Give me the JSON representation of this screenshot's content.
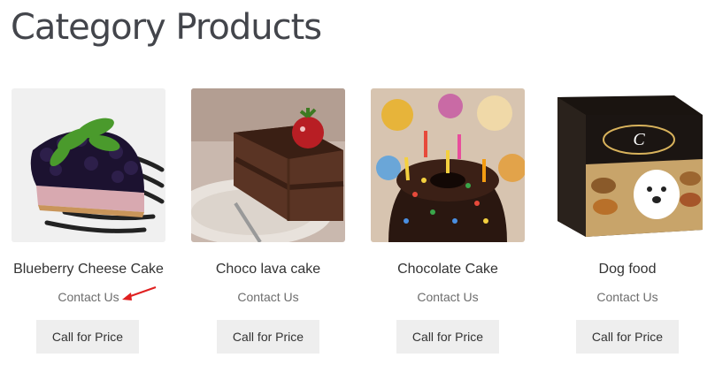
{
  "page_title": "Category Products",
  "products": [
    {
      "name": "Blueberry Cheese Cake",
      "contact_label": "Contact Us",
      "button_label": "Call for Price",
      "image": "blueberry-cheesecake-image"
    },
    {
      "name": "Choco lava cake",
      "contact_label": "Contact Us",
      "button_label": "Call for Price",
      "image": "chocolate-cake-slice-image"
    },
    {
      "name": "Chocolate Cake",
      "contact_label": "Contact Us",
      "button_label": "Call for Price",
      "image": "chocolate-bundt-cake-candles-image"
    },
    {
      "name": "Dog food",
      "contact_label": "Contact Us",
      "button_label": "Call for Price",
      "image": "dog-food-box-image"
    }
  ],
  "annotation": {
    "arrow_color": "#e02020",
    "icon": "red-arrow-icon"
  },
  "colors": {
    "title": "#43454b",
    "button_bg": "#eeeeee",
    "link": "#6d6d6d"
  }
}
